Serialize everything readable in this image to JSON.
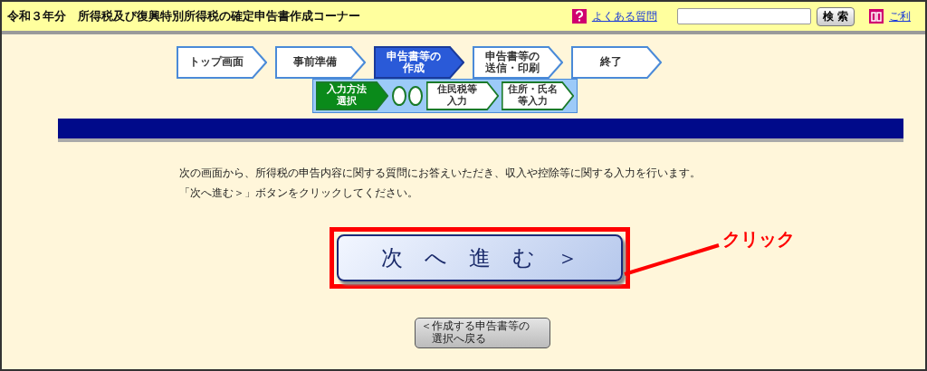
{
  "header": {
    "title": "令和３年分　所得税及び復興特別所得税の確定申告書作成コーナー",
    "faq_link": "よくある質問",
    "search": {
      "button": "検 索"
    },
    "guide_link": "ご利"
  },
  "steps": [
    {
      "label": "トップ画面",
      "selected": false
    },
    {
      "label": "事前準備",
      "selected": false
    },
    {
      "label": "申告書等の作成",
      "selected": true
    },
    {
      "label": "申告書等の送信・印刷",
      "selected": false
    },
    {
      "label": "終了",
      "selected": false
    }
  ],
  "substeps": [
    {
      "kind": "step",
      "label": "入力方法選択",
      "selected": true
    },
    {
      "kind": "dots"
    },
    {
      "kind": "step",
      "label": "住民税等入力",
      "selected": false
    },
    {
      "kind": "step",
      "label": "住所・氏名等入力",
      "selected": false
    }
  ],
  "instructions": [
    "次の画面から、所得税の申告内容に関する質問にお答えいただき、収入や控除等に関する入力を行います。",
    "「次へ進む＞」ボタンをクリックしてください。"
  ],
  "next_button": {
    "label": "次　へ　進　む　＞"
  },
  "annotation": {
    "label": "クリック"
  },
  "back_button": {
    "label": "＜作成する申告書等の選択へ戻る"
  }
}
